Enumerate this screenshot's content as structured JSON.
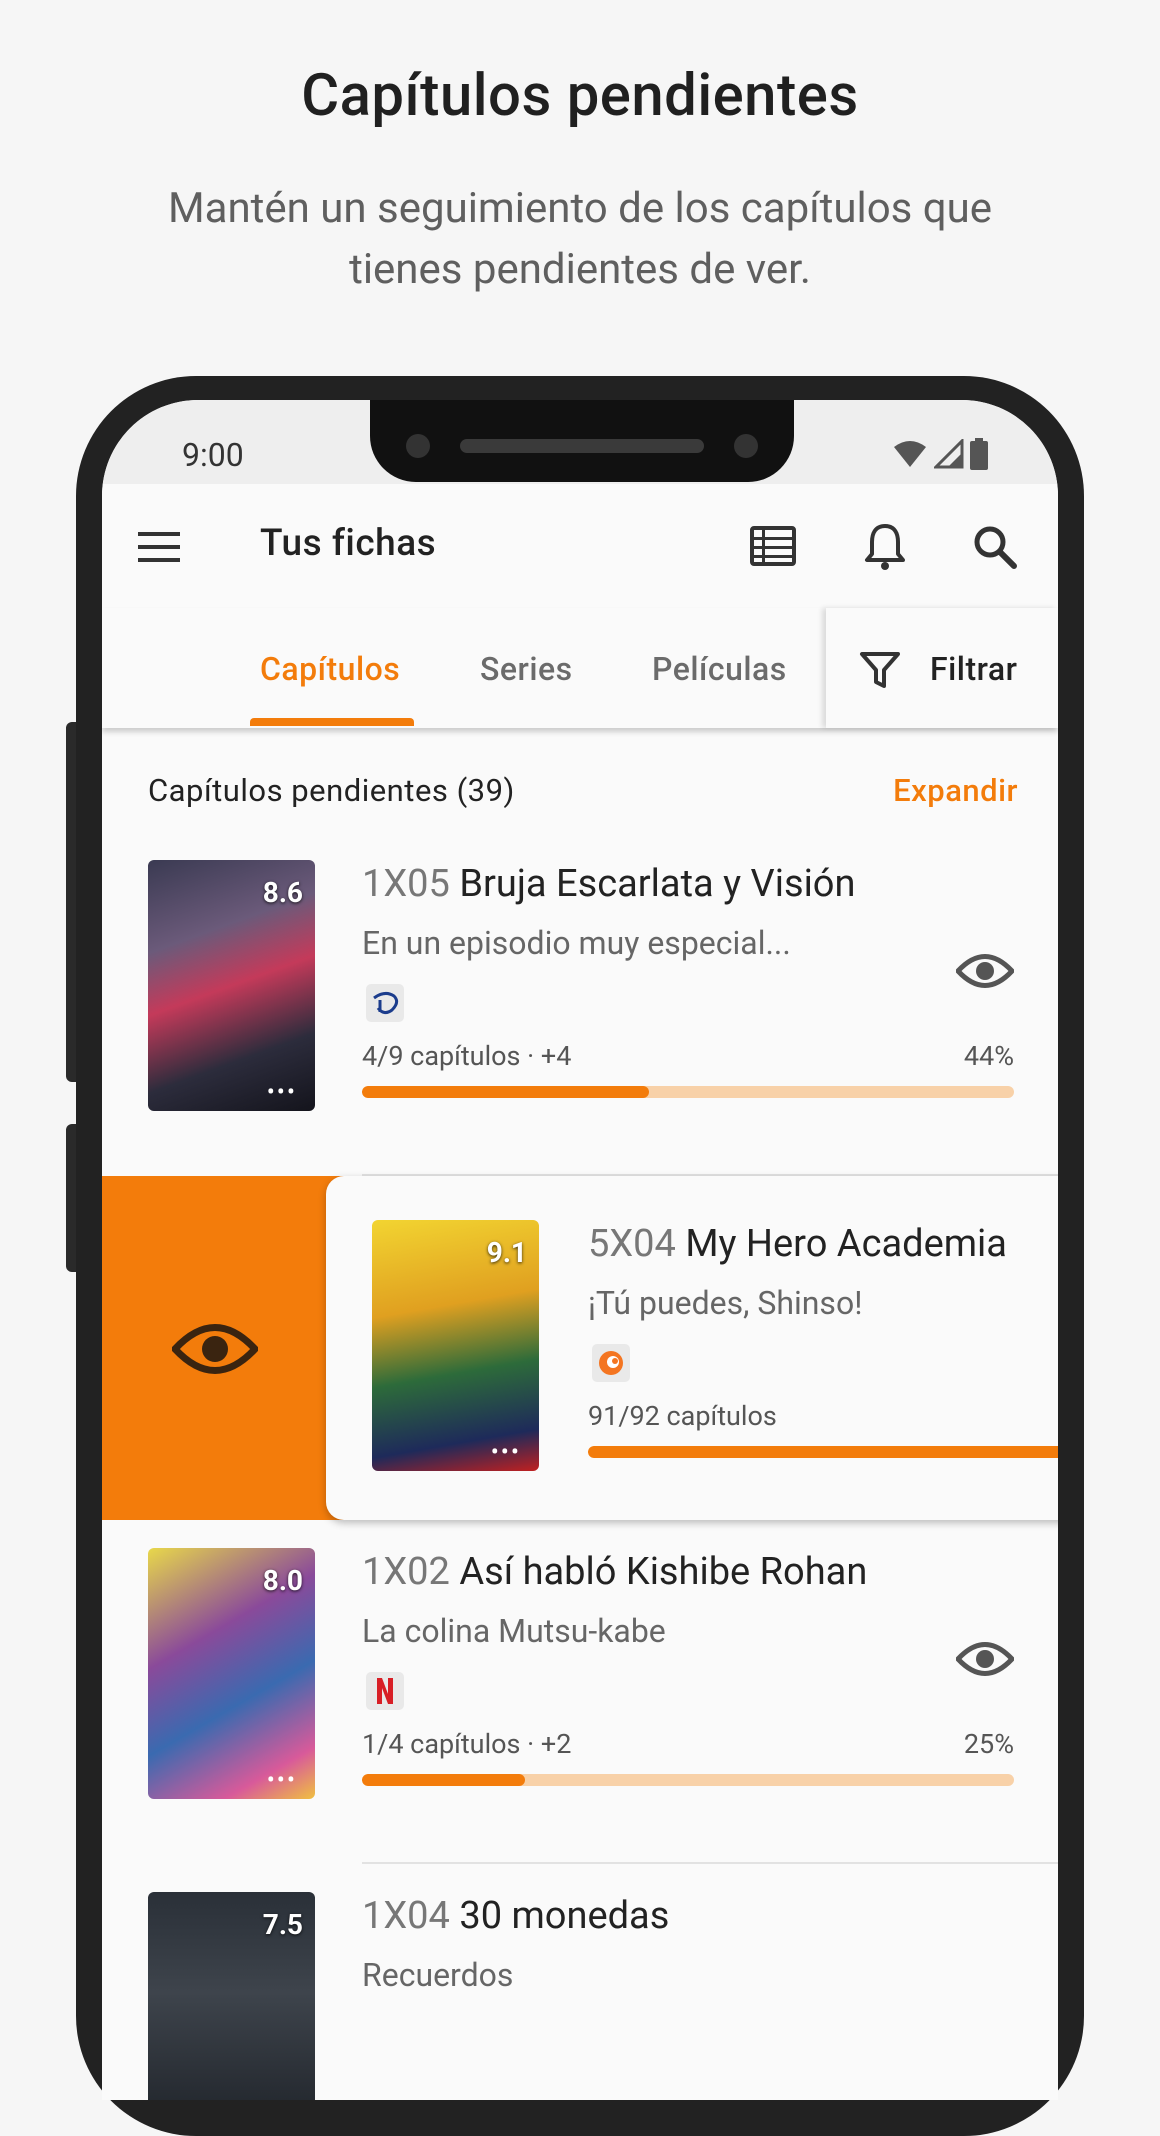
{
  "header": {
    "title": "Capítulos pendientes",
    "subtitle": "Mantén un seguimiento de los capítulos que tienes pendientes de ver."
  },
  "status_bar": {
    "time": "9:00"
  },
  "app_bar": {
    "title": "Tus fichas"
  },
  "tabs": [
    {
      "label": "Capítulos",
      "active": true
    },
    {
      "label": "Series",
      "active": false
    },
    {
      "label": "Películas",
      "active": false
    }
  ],
  "filter": {
    "label": "Filtrar"
  },
  "section": {
    "title": "Capítulos pendientes (39)",
    "action": "Expandir"
  },
  "items": [
    {
      "code": "1X05",
      "title": "Bruja Escarlata y Visión",
      "desc": "En un episodio muy especial...",
      "rating": "8.6",
      "platform": "disney-plus",
      "progress_label": "4/9 capítulos · +4",
      "percent_label": "44%",
      "progress": 0.44
    },
    {
      "code": "5X04",
      "title": "My Hero Academia",
      "desc": "¡Tú puedes, Shinso!",
      "rating": "9.1",
      "platform": "crunchyroll",
      "progress_label": "91/92 capítulos",
      "percent_label": "",
      "progress": 0.99
    },
    {
      "code": "1X02",
      "title": "Así habló Kishibe Rohan",
      "desc": "La colina Mutsu-kabe",
      "rating": "8.0",
      "platform": "netflix",
      "progress_label": "1/4 capítulos · +2",
      "percent_label": "25%",
      "progress": 0.25
    },
    {
      "code": "1X04",
      "title": "30 monedas",
      "desc": "Recuerdos",
      "rating": "7.5"
    }
  ],
  "colors": {
    "accent": "#f37c0b",
    "accent_light": "#f8d1a8"
  }
}
